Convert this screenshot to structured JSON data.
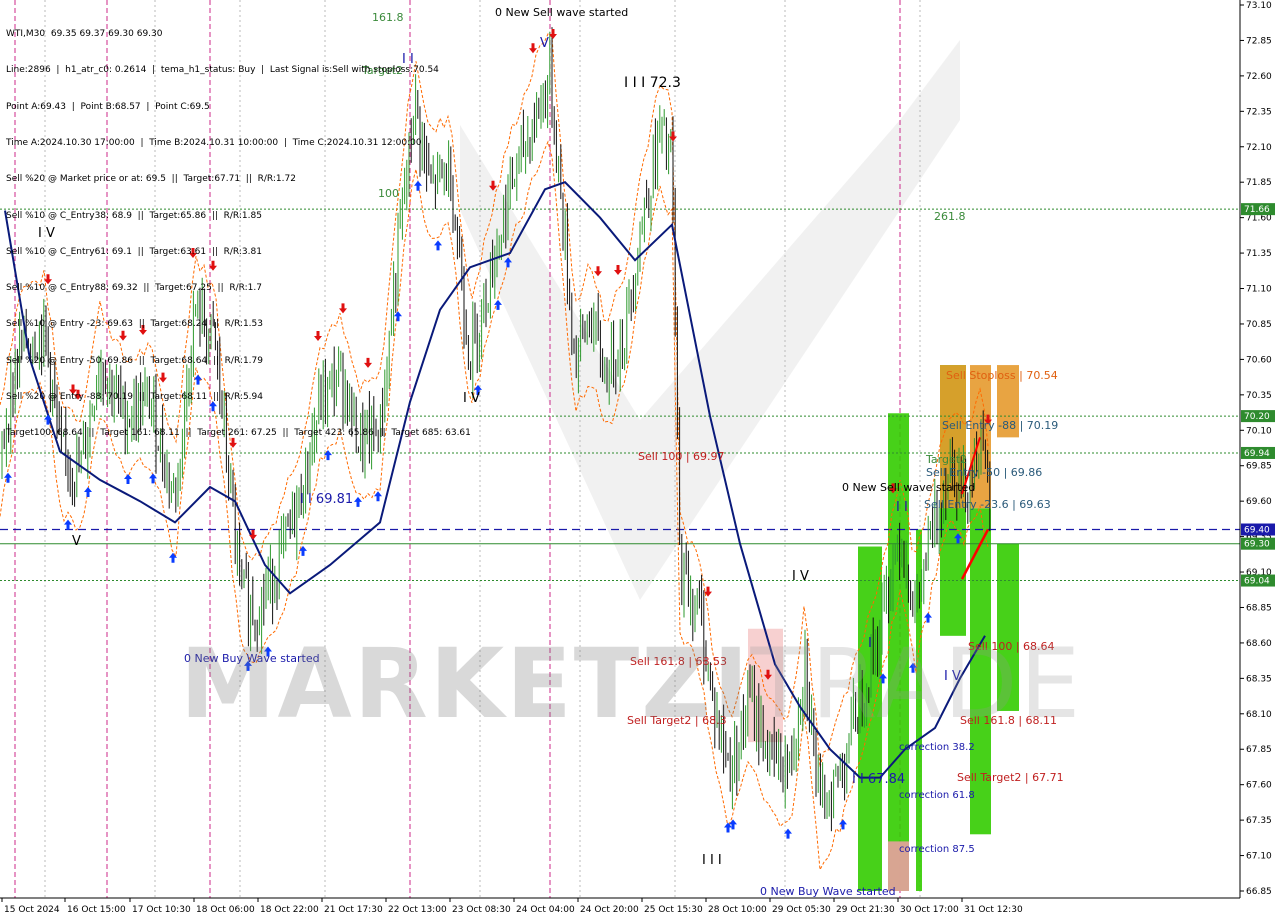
{
  "header": {
    "symbol_line": "WTI,M30  69.35 69.37 69.30 69.30",
    "info_lines": [
      "Line:2896  |  h1_atr_c0: 0.2614  |  tema_h1_status: Buy  |  Last Signal is:Sell with stoploss:70.54",
      "Point A:69.43  |  Point B:68.57  |  Point C:69.5",
      "Time A:2024.10.30 17:00:00  |  Time B:2024.10.31 10:00:00  |  Time C:2024.10.31 12:00:00",
      "Sell %20 @ Market price or at: 69.5  ||  Target:67.71  ||  R/R:1.72",
      "Sell %10 @ C_Entry38: 68.9  ||  Target:65.86  ||  R/R:1.85",
      "Sell %10 @ C_Entry61: 69.1  ||  Target:63.61  ||  R/R:3.81",
      "Sell %10 @ C_Entry88: 69.32  ||  Target:67.25  ||  R/R:1.7",
      "Sell %10 @ Entry -23: 69.63  ||  Target:68.24  ||  R/R:1.53",
      "Sell %20 @ Entry -50: 69.86  ||  Target:68.64  ||  R/R:1.79",
      "Sell %20 @ Entry -88: 70.19  ||  Target:68.11  ||  R/R:5.94",
      "Target100: 68.64  ||  Target 161: 68.11  ||  Target 261: 67.25  ||  Target 423: 65.86  ||  Target 685: 63.61"
    ]
  },
  "watermark": {
    "bold": "MARKETZI",
    "thin": "TRADE"
  },
  "chart_data": {
    "type": "candlestick",
    "symbol": "WTI",
    "timeframe": "M30",
    "ylim": [
      66.85,
      73.1
    ],
    "y_ticks": [
      "73.10",
      "72.85",
      "72.60",
      "72.35",
      "72.10",
      "71.85",
      "71.60",
      "71.35",
      "71.10",
      "70.85",
      "70.60",
      "70.35",
      "70.10",
      "69.85",
      "69.60",
      "69.35",
      "69.10",
      "68.85",
      "68.60",
      "68.35",
      "68.10",
      "67.85",
      "67.60",
      "67.35",
      "67.10",
      "66.85"
    ],
    "x_ticks": [
      "15 Oct 2024",
      "16 Oct 15:00",
      "17 Oct 10:30",
      "18 Oct 06:00",
      "18 Oct 22:00",
      "21 Oct 17:30",
      "22 Oct 13:00",
      "23 Oct 08:30",
      "24 Oct 04:00",
      "24 Oct 20:00",
      "25 Oct 15:30",
      "28 Oct 10:00",
      "29 Oct 05:30",
      "29 Oct 21:30",
      "30 Oct 17:00",
      "31 Oct 12:30"
    ],
    "current_price": 69.3,
    "price_labels": [
      {
        "value": 71.66,
        "text": "71.66",
        "color": "#2e8b2e"
      },
      {
        "value": 70.2,
        "text": "70.20",
        "color": "#2e8b2e"
      },
      {
        "value": 69.94,
        "text": "69.94",
        "color": "#2e8b2e"
      },
      {
        "value": 69.4,
        "text": "69.40",
        "color": "#1a1aaa"
      },
      {
        "value": 69.3,
        "text": "69.30",
        "color": "#2e8b2e"
      },
      {
        "value": 69.04,
        "text": "69.04",
        "color": "#2e8b2e"
      }
    ],
    "levels": [
      {
        "value": 71.66,
        "color": "#2e8b2e",
        "style": "dotted"
      },
      {
        "value": 70.2,
        "color": "#2e8b2e",
        "style": "dotted"
      },
      {
        "value": 69.94,
        "color": "#2e8b2e",
        "style": "dotted"
      },
      {
        "value": 69.4,
        "color": "#1a1aaa",
        "style": "dashed"
      },
      {
        "value": 69.3,
        "color": "#2e8b2e",
        "style": "solid"
      },
      {
        "value": 69.04,
        "color": "#2e8b2e",
        "style": "dotted"
      }
    ],
    "annotations": [
      {
        "text": "0 New Sell wave started",
        "color": "#000000"
      },
      {
        "text": "161.8",
        "color": "#3a8a3a"
      },
      {
        "text": "Target2",
        "color": "#3a8a3a"
      },
      {
        "text": "100",
        "color": "#3a8a3a"
      },
      {
        "text": "261.8",
        "color": "#3a8a3a"
      },
      {
        "text": "I I I 72.3",
        "color": "#000000"
      },
      {
        "text": "I V",
        "color": "#000000"
      },
      {
        "text": "I V",
        "color": "#000000"
      },
      {
        "text": "V",
        "color": "#000000"
      },
      {
        "text": "I I 69.81",
        "color": "#1a1aaa"
      },
      {
        "text": "0 New Buy Wave started",
        "color": "#1a1aaa"
      },
      {
        "text": "Sell 100 | 69.97",
        "color": "#c02020"
      },
      {
        "text": "Sell 161.8 | 68.53",
        "color": "#c02020"
      },
      {
        "text": "Sell Target2 | 68.3",
        "color": "#c02020"
      },
      {
        "text": "I V",
        "color": "#000000"
      },
      {
        "text": "I I I",
        "color": "#000000"
      },
      {
        "text": "I I 67.84",
        "color": "#1a1aaa"
      },
      {
        "text": "0 New Buy Wave started",
        "color": "#1a1aaa"
      },
      {
        "text": "0 New Sell wave started",
        "color": "#000000"
      },
      {
        "text": "Sell Stoploss | 70.54",
        "color": "#e06010"
      },
      {
        "text": "Sell Entry -88 | 70.19",
        "color": "#2a5a7a"
      },
      {
        "text": "Sell Entry -50 | 69.86",
        "color": "#2a5a7a"
      },
      {
        "text": "Sell Entry -23.6 | 69.63",
        "color": "#2a5a7a"
      },
      {
        "text": "Target2",
        "color": "#3a8a3a"
      },
      {
        "text": "Sell 100 | 68.64",
        "color": "#c02020"
      },
      {
        "text": "Sell 161.8 | 68.11",
        "color": "#c02020"
      },
      {
        "text": "Sell Target2 | 67.71",
        "color": "#c02020"
      },
      {
        "text": "correction 38.2",
        "color": "#1a1aaa"
      },
      {
        "text": "correction 61.8",
        "color": "#1a1aaa"
      },
      {
        "text": "correction 87.5",
        "color": "#1a1aaa"
      },
      {
        "text": "I V",
        "color": "#1a1aaa"
      },
      {
        "text": "I",
        "color": "#1a1aaa"
      },
      {
        "text": "V",
        "color": "#1a1aaa"
      },
      {
        "text": "I I",
        "color": "#1a1aaa"
      },
      {
        "text": "I I",
        "color": "#1a1aaa"
      }
    ],
    "colors": {
      "ma": "#0a1a7a",
      "channel": "#ff6a00",
      "buy_arrow": "#0a3cff",
      "sell_arrow": "#e01010",
      "zone_green": "#33cc00",
      "zone_orange": "#e69a2e"
    }
  }
}
